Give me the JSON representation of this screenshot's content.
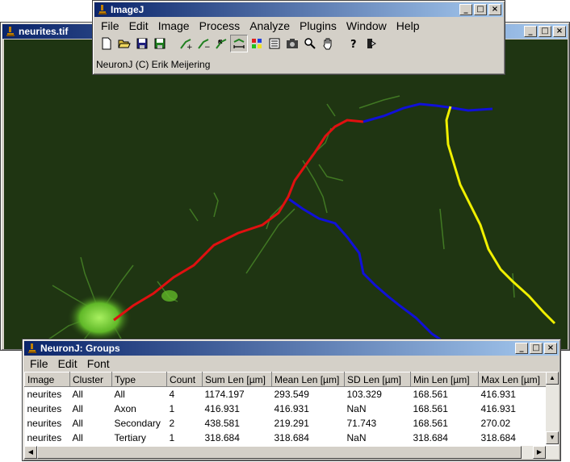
{
  "image_window": {
    "title": "neurites.tif",
    "controls": [
      "_",
      "□",
      "×"
    ]
  },
  "imagej_window": {
    "title": "ImageJ",
    "menu": [
      "File",
      "Edit",
      "Image",
      "Process",
      "Analyze",
      "Plugins",
      "Window",
      "Help"
    ],
    "status": "NeuronJ (C) Erik Meijering",
    "tools": [
      "new-icon",
      "open-icon",
      "save-icon",
      "export-icon",
      "add-tracing-icon",
      "delete-tracing-icon",
      "move-vertex-icon",
      "measure-tracing-icon",
      "colors-icon",
      "labels-icon",
      "snapshot-icon",
      "zoom-icon",
      "hand-icon",
      "help-icon",
      "quit-icon"
    ]
  },
  "groups_window": {
    "title": "NeuronJ: Groups",
    "menu": [
      "File",
      "Edit",
      "Font"
    ],
    "columns": [
      "Image",
      "Cluster",
      "Type",
      "Count",
      "Sum Len [µm]",
      "Mean Len [µm]",
      "SD Len [µm]",
      "Min Len [µm]",
      "Max Len [µm]"
    ],
    "rows": [
      [
        "neurites",
        "All",
        "All",
        "4",
        "1174.197",
        "293.549",
        "103.329",
        "168.561",
        "416.931"
      ],
      [
        "neurites",
        "All",
        "Axon",
        "1",
        "416.931",
        "416.931",
        "NaN",
        "168.561",
        "416.931"
      ],
      [
        "neurites",
        "All",
        "Secondary",
        "2",
        "438.581",
        "219.291",
        "71.743",
        "168.561",
        "270.02"
      ],
      [
        "neurites",
        "All",
        "Tertiary",
        "1",
        "318.684",
        "318.684",
        "NaN",
        "318.684",
        "318.684"
      ]
    ]
  },
  "colors": {
    "axon": "#e01010",
    "secondary": "#1010d8",
    "tertiary": "#f0f000",
    "background": "#1f3512",
    "cell": "#7fd840"
  }
}
